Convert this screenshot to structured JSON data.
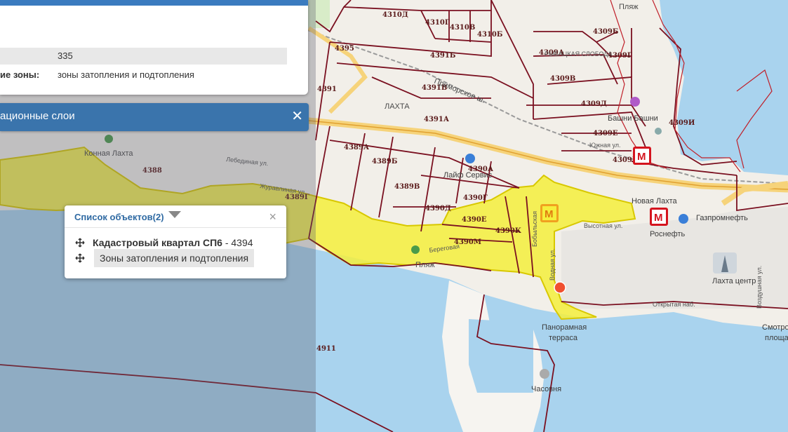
{
  "info_panel": {
    "row1_value": "335",
    "row2_label": "ие зоны:",
    "row2_value": "зоны затопления и подтопления"
  },
  "layers_panel": {
    "title": "ационные слои",
    "close_glyph": "✕"
  },
  "popup": {
    "title": "Список объектов(2)",
    "close_glyph": "×",
    "item1_bold": "Кадастровый квартал СП6",
    "item1_suffix": " - 4394",
    "item2": "Зоны затопления и подтопления"
  },
  "parcels": [
    "4310Д",
    "4310Г",
    "4310В",
    "4310Б",
    "4395",
    "4391Б",
    "4309А",
    "4309Б",
    "4309Г",
    "4309В",
    "4391",
    "4391В",
    "4309Д",
    "4391А",
    "4309Е",
    "4309И",
    "4309Ж",
    "4389А",
    "4389Б",
    "4390А",
    "4388",
    "4389В",
    "4390Г",
    "4390Д",
    "4389Г",
    "4390Е",
    "4390К",
    "4390М",
    "4911"
  ],
  "places": {
    "plyazh_top": "Пляж",
    "lakhta": "ЛАХТА",
    "konnaya_lakhta": "Конная Лахта",
    "slavyanka": "РЫБАЦКАЯ СЛОБОДА",
    "primorskoe": "Приморское ш.",
    "bashni": "Башни Башни",
    "layf_servis": "Лайф Сервис",
    "novaya_lakhta": "Новая Лахта",
    "gazpromneft": "Газпромнефть",
    "rosneft": "Роснефть",
    "lakhta_centr": "Лахта центр",
    "panoramnaya": "Панорамная",
    "terrasa": "терраса",
    "chasovnya": "Часовня",
    "smotrovaya": "Смотро",
    "ploshad": "площа",
    "plyazh_bottom": "Пляж",
    "beregovaya": "Береговая",
    "vodnaya": "Водная ул.",
    "vysotnaya": "Высотная ул.",
    "otkrytaya": "Открытая наб.",
    "vozdushnaya": "Воздушная ул.",
    "lebedinaya": "Лебединая ул.",
    "zhuravlinaya": "Журавлиная ул.",
    "bobylskaya": "Бобыльская",
    "yuzhnaya": "Южная ул.",
    "metro_m": "М"
  },
  "colors": {
    "flood_zone": "#f5ee3c",
    "parcel_border": "#7a1020",
    "water": "#a9d3ee",
    "land": "#f2efe9",
    "panel_blue": "#3a74ac",
    "metro_red": "#d4141e"
  }
}
